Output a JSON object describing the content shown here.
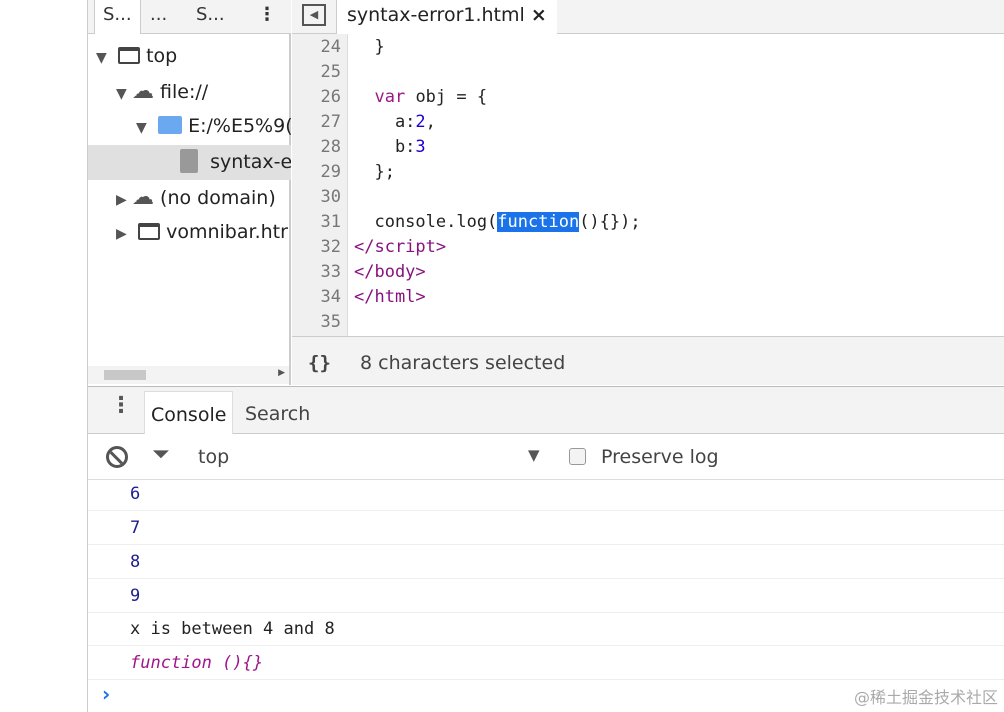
{
  "navigator": {
    "tabs": [
      "S...",
      "...",
      "S..."
    ],
    "tree": [
      {
        "label": "top",
        "icon": "frame-icon",
        "expanded": true
      },
      {
        "label": "file://",
        "icon": "cloud-icon",
        "expanded": true
      },
      {
        "label": "E:/%E5%9(",
        "icon": "folder-icon",
        "expanded": true
      },
      {
        "label": "syntax-e",
        "icon": "file-icon",
        "selected": true
      },
      {
        "label": "(no domain)",
        "icon": "cloud-icon",
        "expanded": false
      },
      {
        "label": "vomnibar.htr",
        "icon": "frame-icon",
        "expanded": false
      }
    ]
  },
  "editor": {
    "file_tab": "syntax-error1.html",
    "close": "×",
    "line_numbers": [
      "24",
      "25",
      "26",
      "27",
      "28",
      "29",
      "30",
      "31",
      "32",
      "33",
      "34",
      "35"
    ],
    "status": "8 characters selected",
    "format_icon": "{}"
  },
  "drawer": {
    "tabs": [
      "Console",
      "Search"
    ]
  },
  "console": {
    "context": "top",
    "preserve_log": "Preserve log",
    "preserve_checked": false,
    "messages": [
      "6",
      "7",
      "8",
      "9",
      "x is between 4 and 8",
      "function (){}"
    ],
    "prompt": "›"
  },
  "watermark": "@稀土掘金技术社区"
}
